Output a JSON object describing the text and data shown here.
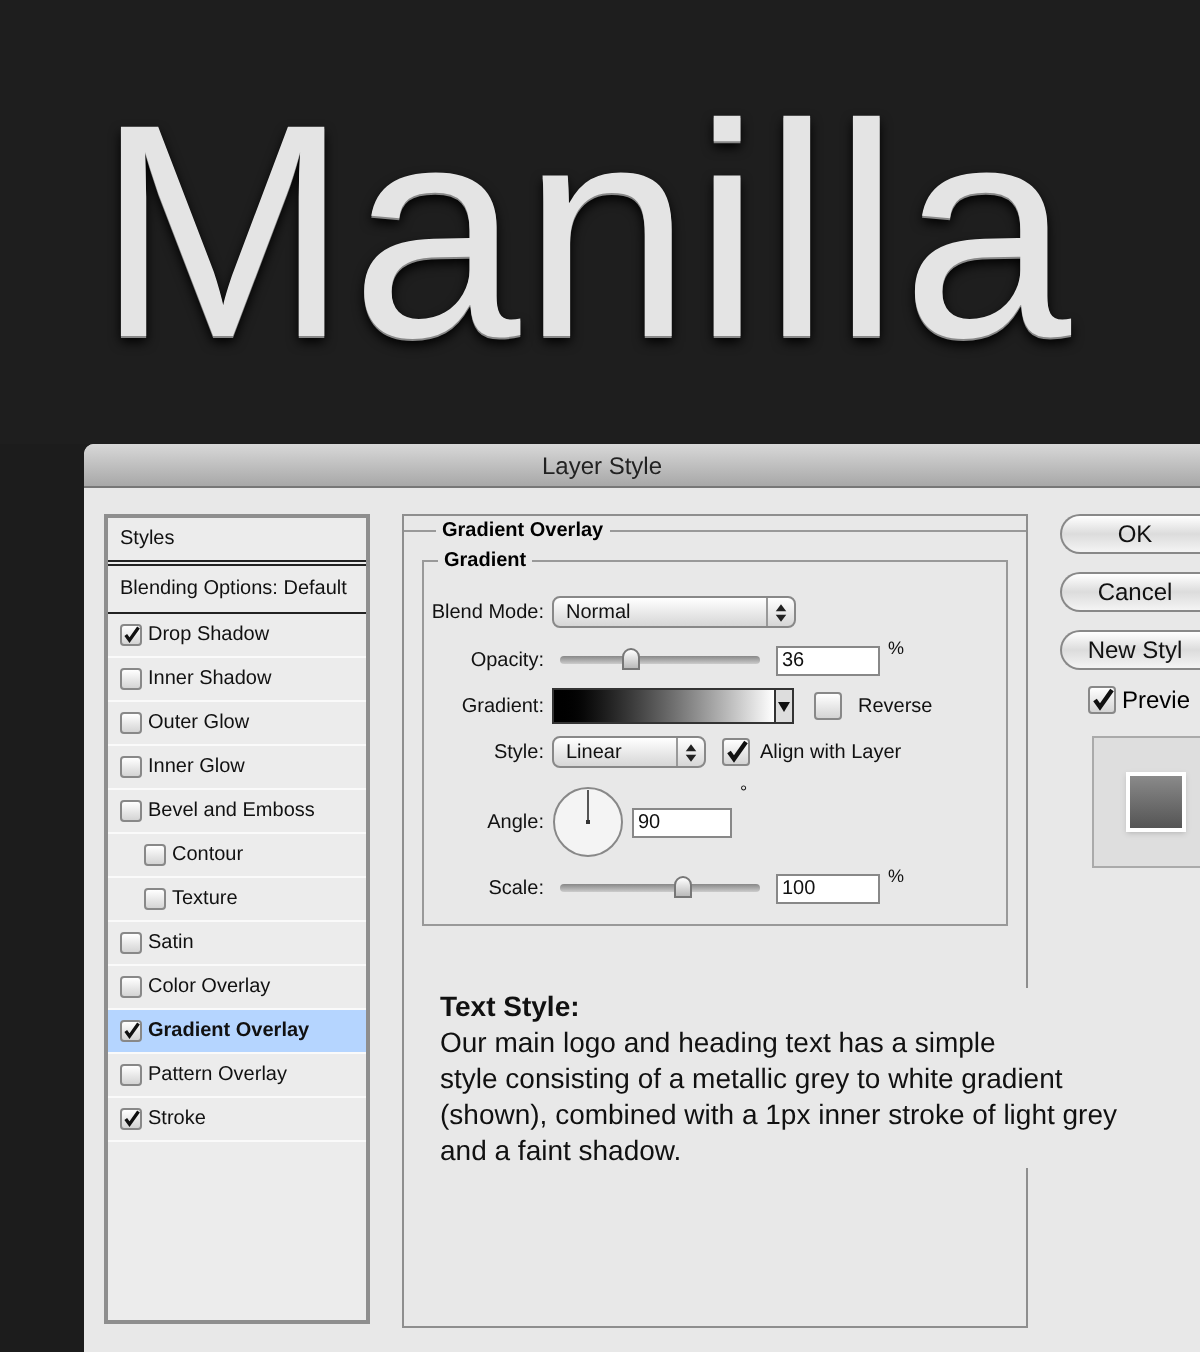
{
  "logo_text": "Manilla",
  "dialog": {
    "title": "Layer Style",
    "styles_list": [
      {
        "kind": "header",
        "label": "Styles",
        "selected": false
      },
      {
        "kind": "header",
        "label": "Blending Options: Default",
        "selected": false
      },
      {
        "kind": "effect",
        "label": "Drop Shadow",
        "checked": true,
        "selected": false
      },
      {
        "kind": "effect",
        "label": "Inner Shadow",
        "checked": false,
        "selected": false
      },
      {
        "kind": "effect",
        "label": "Outer Glow",
        "checked": false,
        "selected": false
      },
      {
        "kind": "effect",
        "label": "Inner Glow",
        "checked": false,
        "selected": false
      },
      {
        "kind": "effect",
        "label": "Bevel and Emboss",
        "checked": false,
        "selected": false,
        "children": [
          {
            "kind": "effect",
            "label": "Contour",
            "checked": false,
            "selected": false
          },
          {
            "kind": "effect",
            "label": "Texture",
            "checked": false,
            "selected": false
          }
        ]
      },
      {
        "kind": "effect",
        "label": "Satin",
        "checked": false,
        "selected": false
      },
      {
        "kind": "effect",
        "label": "Color Overlay",
        "checked": false,
        "selected": false
      },
      {
        "kind": "effect",
        "label": "Gradient Overlay",
        "checked": true,
        "selected": true
      },
      {
        "kind": "effect",
        "label": "Pattern Overlay",
        "checked": false,
        "selected": false
      },
      {
        "kind": "effect",
        "label": "Stroke",
        "checked": true,
        "selected": false
      }
    ],
    "gradient_overlay": {
      "title": "Gradient Overlay",
      "group_title": "Gradient",
      "blend_mode": {
        "label": "Blend Mode:",
        "value": "Normal"
      },
      "opacity": {
        "label": "Opacity:",
        "level": 0.35,
        "value": "36",
        "unit": "%"
      },
      "gradient": {
        "label": "Gradient:"
      },
      "reverse": {
        "label": "Reverse",
        "checked": false
      },
      "style": {
        "label": "Style:",
        "value": "Linear"
      },
      "align_with_layer": {
        "label": "Align with Layer",
        "checked": true
      },
      "angle": {
        "label": "Angle:",
        "value": "90",
        "unit": "°"
      },
      "scale": {
        "label": "Scale:",
        "level": 0.61,
        "value": "100",
        "unit": "%"
      }
    },
    "buttons": [
      {
        "label": "OK"
      },
      {
        "label": "Cancel"
      },
      {
        "label": "New Styl"
      }
    ],
    "preview": {
      "label": "Previe",
      "checked": true
    }
  },
  "annotation": {
    "heading": "Text Style:",
    "body_lines": [
      "Our main logo and heading text has a simple",
      "style consisting of a metallic grey to white gradient",
      "(shown), combined with a 1px inner stroke of light grey",
      "and a faint shadow."
    ]
  }
}
